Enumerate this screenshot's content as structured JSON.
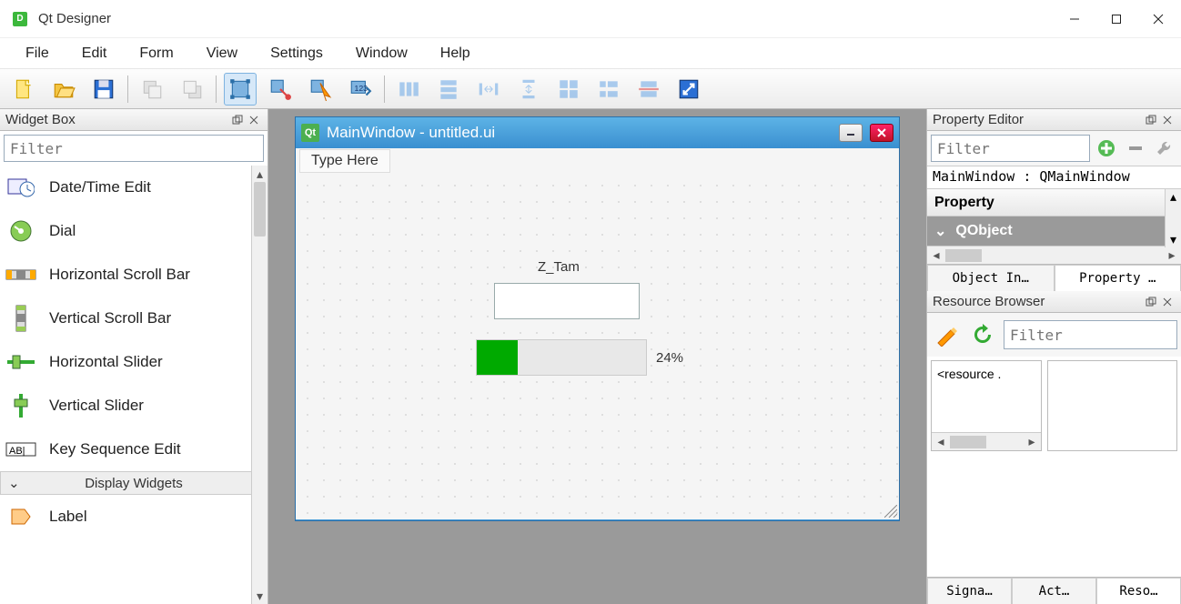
{
  "app": {
    "title": "Qt Designer"
  },
  "menus": [
    "File",
    "Edit",
    "Form",
    "View",
    "Settings",
    "Window",
    "Help"
  ],
  "widget_box": {
    "title": "Widget Box",
    "filter_placeholder": "Filter",
    "items": [
      {
        "icon": "datetime",
        "label": "Date/Time Edit"
      },
      {
        "icon": "dial",
        "label": "Dial"
      },
      {
        "icon": "hscroll",
        "label": "Horizontal Scroll Bar"
      },
      {
        "icon": "vscroll",
        "label": "Vertical Scroll Bar"
      },
      {
        "icon": "hslider",
        "label": "Horizontal Slider"
      },
      {
        "icon": "vslider",
        "label": "Vertical Slider"
      },
      {
        "icon": "keyseq",
        "label": "Key Sequence Edit"
      }
    ],
    "category": "Display Widgets",
    "after_items": [
      {
        "icon": "label",
        "label": "Label"
      }
    ]
  },
  "form": {
    "title": "MainWindow - untitled.ui",
    "type_here": "Type Here",
    "label_text": "Z_Tam",
    "progress_value": 24,
    "progress_text": "24%"
  },
  "property_editor": {
    "title": "Property Editor",
    "filter_placeholder": "Filter",
    "object_line": "MainWindow : QMainWindow",
    "header": "Property",
    "group": "QObject",
    "tabs": [
      "Object In…",
      "Property …"
    ]
  },
  "resource_browser": {
    "title": "Resource Browser",
    "filter_placeholder": "Filter",
    "root": "<resource ."
  },
  "bottom_tabs": [
    "Signa…",
    "Act…",
    "Reso…"
  ]
}
